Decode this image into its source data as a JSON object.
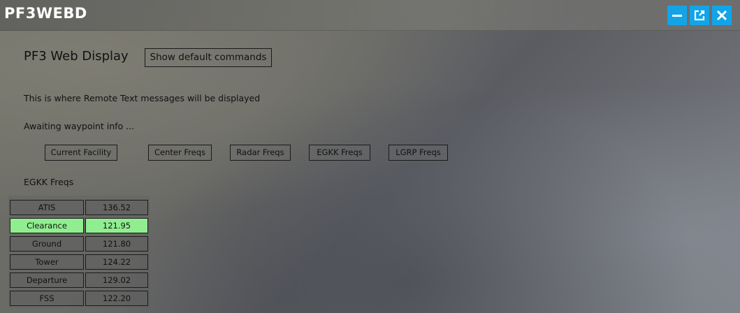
{
  "window": {
    "title": "PF3WEBD",
    "accent_color": "#13a4e8",
    "controls": [
      {
        "icon": "minimize-icon"
      },
      {
        "icon": "popout-icon"
      },
      {
        "icon": "close-icon"
      }
    ]
  },
  "header": {
    "title": "PF3 Web Display",
    "default_commands_label": "Show default commands"
  },
  "messages": {
    "remote_text": "This is where Remote Text messages will be displayed",
    "waypoint": "Awaiting waypoint info ..."
  },
  "freq_tabs": [
    {
      "label": "Current Facility"
    },
    {
      "label": "Center Freqs"
    },
    {
      "label": "Radar Freqs"
    },
    {
      "label": "EGKK Freqs"
    },
    {
      "label": "LGRP Freqs"
    }
  ],
  "freq_section": {
    "title": "EGKK Freqs",
    "highlight_color": "#90ee90",
    "rows": [
      {
        "name": "ATIS",
        "freq": "136.52",
        "active": false
      },
      {
        "name": "Clearance",
        "freq": "121.95",
        "active": true
      },
      {
        "name": "Ground",
        "freq": "121.80",
        "active": false
      },
      {
        "name": "Tower",
        "freq": "124.22",
        "active": false
      },
      {
        "name": "Departure",
        "freq": "129.02",
        "active": false
      },
      {
        "name": "FSS",
        "freq": "122.20",
        "active": false
      }
    ]
  }
}
